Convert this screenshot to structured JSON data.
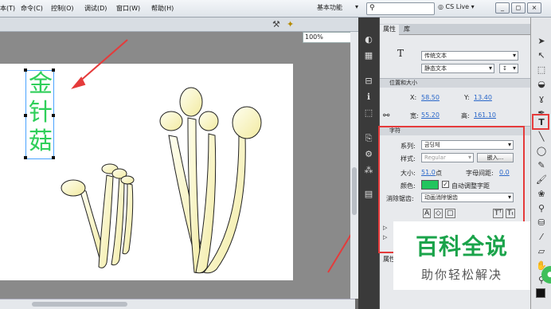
{
  "menu": {
    "items": [
      "本(T)",
      "命令(C)",
      "控制(O)",
      "调试(D)",
      "窗口(W)",
      "帮助(H)"
    ],
    "workspace": "基本功能",
    "cs_live": "CS Live",
    "window_buttons": [
      "_",
      "◻",
      "×"
    ]
  },
  "stage": {
    "zoom": "100%",
    "vertical_text": [
      "金",
      "针",
      "菇"
    ]
  },
  "panel": {
    "tabs": [
      "属性",
      "库"
    ],
    "text_type": "传统文本",
    "text_mode": "静态文本",
    "position_section": "位置和大小",
    "x_label": "X:",
    "x_value": "58.50",
    "y_label": "Y:",
    "y_value": "13.40",
    "w_label": "宽:",
    "w_value": "55.20",
    "h_label": "高:",
    "h_value": "161.10",
    "char_section": "字符",
    "family_label": "系列:",
    "family_value": "금딩체",
    "style_label": "样式:",
    "style_value": "Regular",
    "embed_button": "嵌入...",
    "size_label": "大小:",
    "size_value": "51.0",
    "size_unit": "点",
    "spacing_label": "字母间距:",
    "spacing_value": "0.0",
    "color_label": "颜色:",
    "color": "#22c55e",
    "auto_kern": "自动调整字距",
    "aa_label": "消除锯齿:",
    "aa_value": "动画消除锯齿",
    "bottom_tab": "属性"
  },
  "watermark": {
    "title": "百科全说",
    "subtitle": "助你轻松解决"
  }
}
